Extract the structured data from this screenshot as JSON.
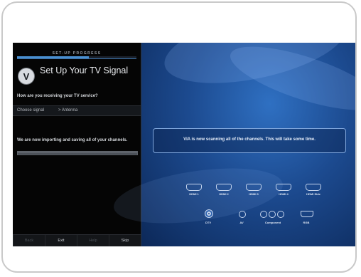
{
  "setup": {
    "progress_label": "SET-UP PROGRESS",
    "progress_fraction": 0.6,
    "logo_letter": "V",
    "title": "Set Up Your TV Signal",
    "question": "How are you receiving your TV service?",
    "choose_label": "Choose signal",
    "choose_value": "> Antenna",
    "status": "We are now importing and saving all of your channels."
  },
  "buttons": [
    {
      "label": "Back",
      "enabled": false
    },
    {
      "label": "Exit",
      "enabled": true
    },
    {
      "label": "Help",
      "enabled": false
    },
    {
      "label": "Skip",
      "enabled": true
    }
  ],
  "scan": {
    "message": "VIA is now scanning all of the channels. This will take some time."
  },
  "inputs": {
    "hdmi": [
      "HDMI 1",
      "HDMI 2",
      "HDMI 3",
      "HDMI 4",
      "HDMI Side"
    ],
    "other": [
      "DTV",
      "AV",
      "Component",
      "RGB"
    ]
  },
  "colors": {
    "background_blue": "#1c4a8f",
    "progress_blue": "#4a8fd0"
  }
}
